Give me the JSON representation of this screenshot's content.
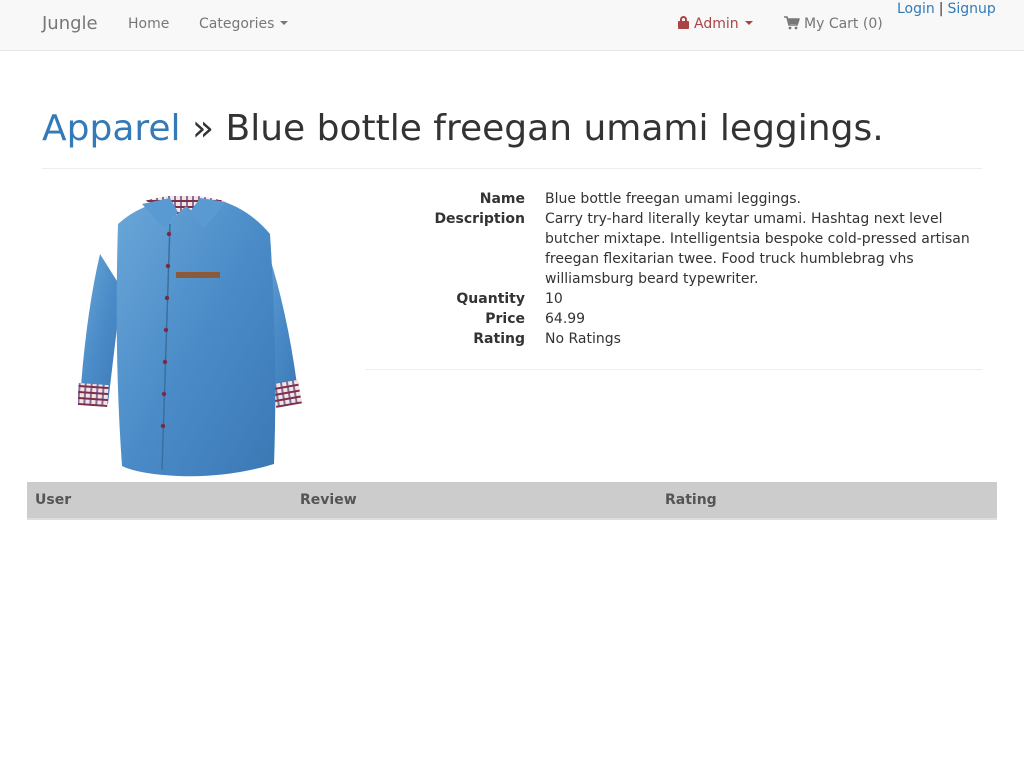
{
  "navbar": {
    "brand": "Jungle",
    "home_label": "Home",
    "categories_label": "Categories",
    "admin_label": "Admin",
    "cart_label": "My Cart (0)",
    "login_label": "Login",
    "separator": "|",
    "signup_label": "Signup"
  },
  "title": {
    "category": "Apparel",
    "separator": "»",
    "product_name": "Blue bottle freegan umami leggings."
  },
  "product": {
    "image_icon": "blue-denim-shirt",
    "fields": [
      {
        "label": "Name",
        "value": "Blue bottle freegan umami leggings."
      },
      {
        "label": "Description",
        "value": "Carry try-hard literally keytar umami. Hashtag next level butcher mixtape. Intelligentsia bespoke cold-pressed artisan freegan flexitarian twee. Food truck humblebrag vhs williamsburg beard typewriter."
      },
      {
        "label": "Quantity",
        "value": "10"
      },
      {
        "label": "Price",
        "value": "64.99"
      },
      {
        "label": "Rating",
        "value": "No Ratings"
      }
    ]
  },
  "reviews": {
    "columns": [
      "User",
      "Review",
      "Rating"
    ],
    "rows": []
  },
  "colors": {
    "navbar_bg": "#f8f8f8",
    "link": "#337ab7",
    "admin": "#a94442",
    "table_header_bg": "#cccccc"
  }
}
